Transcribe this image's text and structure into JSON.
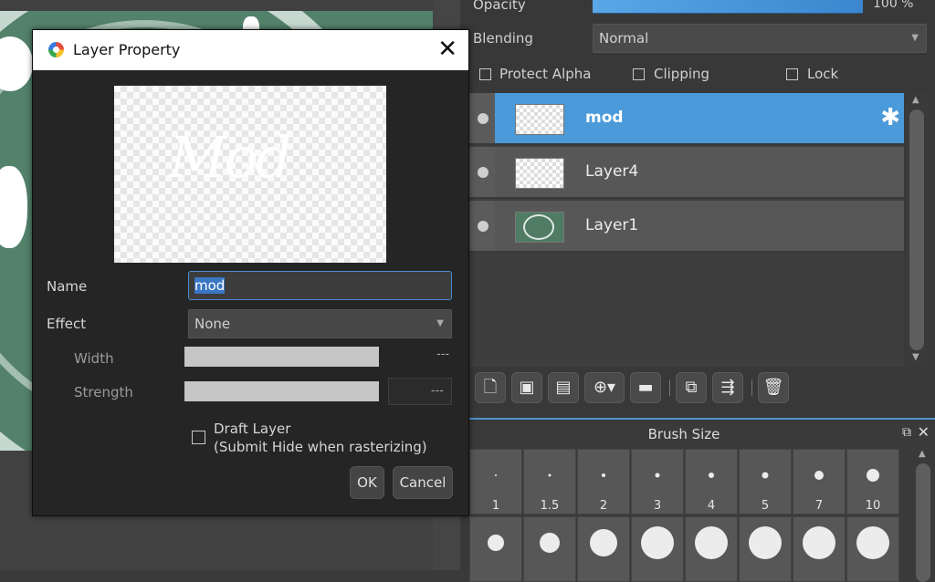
{
  "layers_panel": {
    "opacity_label": "Opacity",
    "opacity_value": "100 %",
    "opacity_fraction": 1.0,
    "blending_label": "Blending",
    "blending_value": "Normal",
    "protect_alpha_label": "Protect Alpha",
    "clipping_label": "Clipping",
    "lock_label": "Lock",
    "layers": [
      {
        "name": "mod",
        "selected": true
      },
      {
        "name": "Layer4",
        "selected": false
      },
      {
        "name": "Layer1",
        "selected": false
      }
    ],
    "toolbar_icons": [
      "new-layer-icon",
      "new-8bit-layer-icon",
      "new-1bit-layer-icon",
      "add-layer-menu-icon",
      "folder-icon",
      "duplicate-layer-icon",
      "merge-down-icon",
      "trash-icon"
    ]
  },
  "brush_panel": {
    "title": "Brush Size",
    "sizes": [
      "1",
      "1.5",
      "2",
      "3",
      "4",
      "5",
      "7",
      "10"
    ]
  },
  "dialog": {
    "title": "Layer Property",
    "preview_text": "Mod",
    "name_label": "Name",
    "name_value": "mod",
    "effect_label": "Effect",
    "effect_value": "None",
    "width_label": "Width",
    "width_value": "---",
    "strength_label": "Strength",
    "strength_value": "---",
    "draft_layer_label": "Draft Layer",
    "draft_layer_sub": "(Submit Hide when rasterizing)",
    "ok_label": "OK",
    "cancel_label": "Cancel"
  },
  "colors": {
    "accent": "#4b9ad9",
    "canvas_green": "#53816a"
  }
}
